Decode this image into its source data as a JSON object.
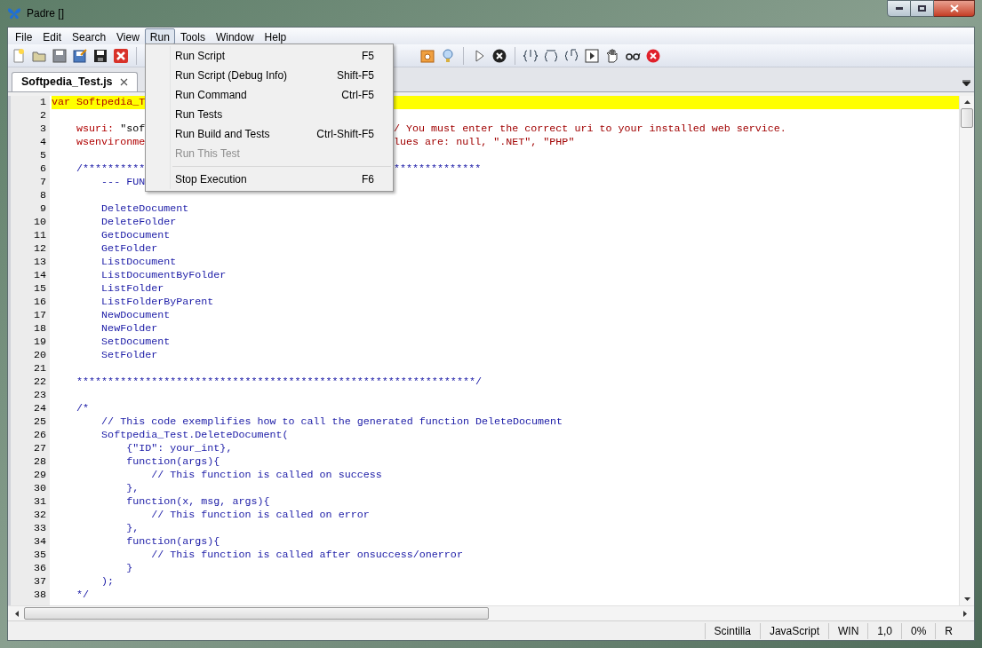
{
  "window": {
    "title": "Padre []"
  },
  "menu_bar": [
    {
      "label": "File",
      "selected": false
    },
    {
      "label": "Edit",
      "selected": false
    },
    {
      "label": "Search",
      "selected": false
    },
    {
      "label": "View",
      "selected": false
    },
    {
      "label": "Run",
      "selected": true
    },
    {
      "label": "Tools",
      "selected": false
    },
    {
      "label": "Window",
      "selected": false
    },
    {
      "label": "Help",
      "selected": false
    }
  ],
  "run_menu": [
    {
      "kind": "item",
      "label": "Run Script",
      "shortcut": "F5",
      "disabled": false
    },
    {
      "kind": "item",
      "label": "Run Script (Debug Info)",
      "shortcut": "Shift-F5",
      "disabled": false
    },
    {
      "kind": "item",
      "label": "Run Command",
      "shortcut": "Ctrl-F5",
      "disabled": false
    },
    {
      "kind": "item",
      "label": "Run Tests",
      "disabled": false
    },
    {
      "kind": "item",
      "label": "Run Build and Tests",
      "shortcut": "Ctrl-Shift-F5",
      "disabled": false
    },
    {
      "kind": "item",
      "label": "Run This Test",
      "disabled": true
    },
    {
      "kind": "separator"
    },
    {
      "kind": "item",
      "label": "Stop Execution",
      "shortcut": "F6",
      "disabled": false
    }
  ],
  "tabs": [
    {
      "label": "Softpedia_Test.js",
      "selected": true
    }
  ],
  "editor": {
    "lines": [
      {
        "number": "1",
        "current": true,
        "parts": [
          {
            "kind": "name",
            "text": "var Softpedia_T"
          }
        ]
      },
      {
        "number": "2",
        "current": false
      },
      {
        "number": "3",
        "current": false,
        "parts": [
          {
            "kind": "name",
            "text": "    wsuri: "
          },
          {
            "kind": "plain",
            "text": "\"sof"
          }
        ],
        "tail": [
          {
            "kind": "comment",
            "text": "/ You must enter the correct uri to your installed web service."
          }
        ]
      },
      {
        "number": "4",
        "current": false,
        "parts": [
          {
            "kind": "name",
            "text": "    wsenvironme"
          }
        ],
        "tail": [
          {
            "kind": "comment",
            "text": "lues are: null, \".NET\", \"PHP\""
          }
        ]
      },
      {
        "number": "5",
        "current": false
      },
      {
        "number": "6",
        "current": false,
        "parts": [
          {
            "kind": "doc",
            "text": "    /**********"
          }
        ],
        "tail": [
          {
            "kind": "doc",
            "text": "**************"
          }
        ]
      },
      {
        "number": "7",
        "current": false,
        "parts": [
          {
            "kind": "doc",
            "text": "        --- FUN"
          }
        ]
      },
      {
        "number": "8",
        "current": false
      },
      {
        "number": "9",
        "current": false,
        "parts": [
          {
            "kind": "doc",
            "text": "        DeleteDocument"
          }
        ]
      },
      {
        "number": "10",
        "current": false,
        "parts": [
          {
            "kind": "doc",
            "text": "        DeleteFolder"
          }
        ]
      },
      {
        "number": "11",
        "current": false,
        "parts": [
          {
            "kind": "doc",
            "text": "        GetDocument"
          }
        ]
      },
      {
        "number": "12",
        "current": false,
        "parts": [
          {
            "kind": "doc",
            "text": "        GetFolder"
          }
        ]
      },
      {
        "number": "13",
        "current": false,
        "parts": [
          {
            "kind": "doc",
            "text": "        ListDocument"
          }
        ]
      },
      {
        "number": "14",
        "current": false,
        "parts": [
          {
            "kind": "doc",
            "text": "        ListDocumentByFolder"
          }
        ]
      },
      {
        "number": "15",
        "current": false,
        "parts": [
          {
            "kind": "doc",
            "text": "        ListFolder"
          }
        ]
      },
      {
        "number": "16",
        "current": false,
        "parts": [
          {
            "kind": "doc",
            "text": "        ListFolderByParent"
          }
        ]
      },
      {
        "number": "17",
        "current": false,
        "parts": [
          {
            "kind": "doc",
            "text": "        NewDocument"
          }
        ]
      },
      {
        "number": "18",
        "current": false,
        "parts": [
          {
            "kind": "doc",
            "text": "        NewFolder"
          }
        ]
      },
      {
        "number": "19",
        "current": false,
        "parts": [
          {
            "kind": "doc",
            "text": "        SetDocument"
          }
        ]
      },
      {
        "number": "20",
        "current": false,
        "parts": [
          {
            "kind": "doc",
            "text": "        SetFolder"
          }
        ]
      },
      {
        "number": "21",
        "current": false
      },
      {
        "number": "22",
        "current": false,
        "parts": [
          {
            "kind": "doc",
            "text": "    ****************************************************************/"
          }
        ]
      },
      {
        "number": "23",
        "current": false
      },
      {
        "number": "24",
        "current": false,
        "parts": [
          {
            "kind": "doc",
            "text": "    /*"
          }
        ]
      },
      {
        "number": "25",
        "current": false,
        "parts": [
          {
            "kind": "doc",
            "text": "        // This code exemplifies how to call the generated function DeleteDocument"
          }
        ]
      },
      {
        "number": "26",
        "current": false,
        "parts": [
          {
            "kind": "doc",
            "text": "        Softpedia_Test.DeleteDocument("
          }
        ]
      },
      {
        "number": "27",
        "current": false,
        "parts": [
          {
            "kind": "doc",
            "text": "            {\"ID\": your_int},"
          }
        ]
      },
      {
        "number": "28",
        "current": false,
        "parts": [
          {
            "kind": "doc",
            "text": "            function(args){"
          }
        ]
      },
      {
        "number": "29",
        "current": false,
        "parts": [
          {
            "kind": "doc",
            "text": "                // This function is called on success"
          }
        ]
      },
      {
        "number": "30",
        "current": false,
        "parts": [
          {
            "kind": "doc",
            "text": "            },"
          }
        ]
      },
      {
        "number": "31",
        "current": false,
        "parts": [
          {
            "kind": "doc",
            "text": "            function(x, msg, args){"
          }
        ]
      },
      {
        "number": "32",
        "current": false,
        "parts": [
          {
            "kind": "doc",
            "text": "                // This function is called on error"
          }
        ]
      },
      {
        "number": "33",
        "current": false,
        "parts": [
          {
            "kind": "doc",
            "text": "            },"
          }
        ]
      },
      {
        "number": "34",
        "current": false,
        "parts": [
          {
            "kind": "doc",
            "text": "            function(args){"
          }
        ]
      },
      {
        "number": "35",
        "current": false,
        "parts": [
          {
            "kind": "doc",
            "text": "                // This function is called after onsuccess/onerror"
          }
        ]
      },
      {
        "number": "36",
        "current": false,
        "parts": [
          {
            "kind": "doc",
            "text": "            }"
          }
        ]
      },
      {
        "number": "37",
        "current": false,
        "parts": [
          {
            "kind": "doc",
            "text": "        );"
          }
        ]
      },
      {
        "number": "38",
        "current": false,
        "parts": [
          {
            "kind": "doc",
            "text": "    */"
          }
        ]
      }
    ]
  },
  "status_bar": [
    "Scintilla",
    "JavaScript",
    "WIN",
    "1,0",
    "0%",
    "R"
  ]
}
